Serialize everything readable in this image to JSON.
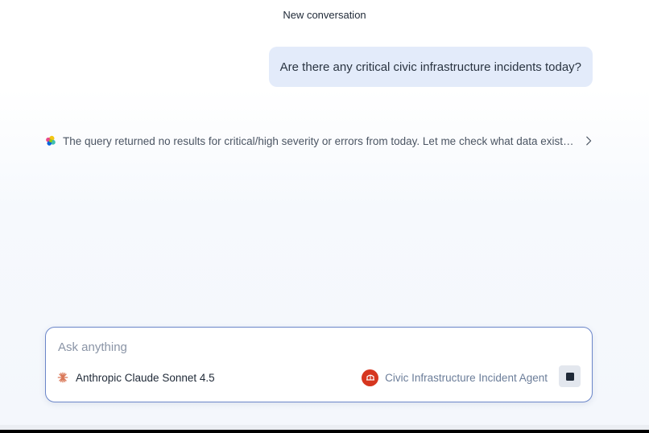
{
  "header": {
    "title": "New conversation"
  },
  "messages": {
    "user": {
      "text": "Are there any critical civic infrastructure incidents today?"
    },
    "assistant_reasoning": {
      "text": "The query returned no results for critical/high severity or errors from today. Let me check what data exists in the index...",
      "icon": "elastic-logo-icon",
      "expand_icon": "chevron-right-icon"
    }
  },
  "composer": {
    "placeholder": "Ask anything",
    "value": "",
    "model": {
      "label": "Anthropic Claude Sonnet 4.5",
      "icon": "anthropic-spark-icon",
      "color": "#d97757"
    },
    "agent": {
      "label": "Civic Infrastructure Incident Agent",
      "icon": "bridge-icon",
      "color": "#d6361f"
    },
    "stop_button": {
      "icon": "stop-icon"
    }
  }
}
